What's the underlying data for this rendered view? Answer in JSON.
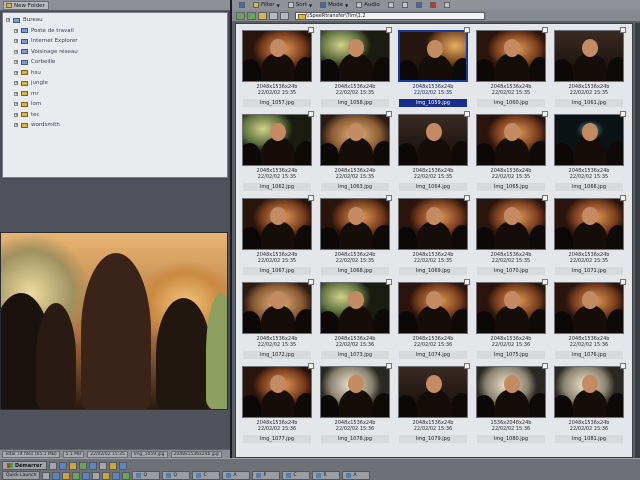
{
  "left": {
    "new_folder_label": "New Folder",
    "tree": [
      {
        "label": "Bureau",
        "kind": "sys",
        "indent": false
      },
      {
        "label": "Poste de travail",
        "kind": "sys",
        "indent": true
      },
      {
        "label": "Internet Explorer",
        "kind": "sys",
        "indent": true
      },
      {
        "label": "Voisinage réseau",
        "kind": "sys",
        "indent": true
      },
      {
        "label": "Corbeille",
        "kind": "sys",
        "indent": true
      },
      {
        "label": "hsu",
        "kind": "folder",
        "indent": true
      },
      {
        "label": "jungle",
        "kind": "folder",
        "indent": true
      },
      {
        "label": "mr",
        "kind": "folder",
        "indent": true
      },
      {
        "label": "lom",
        "kind": "folder",
        "indent": true
      },
      {
        "label": "tec",
        "kind": "folder",
        "indent": true
      },
      {
        "label": "wordsmith",
        "kind": "folder",
        "indent": true
      }
    ],
    "status": {
      "total": "Total 74 files (65.1 MB)",
      "size": "5.1 MB",
      "date": "22/02/02 15:35",
      "file": "Img_1059.jpg",
      "dims": "2048x1536x24b jpg"
    }
  },
  "toolbar": {
    "filter_label": "Filter",
    "sort_label": "Sort",
    "mode_label": "Mode",
    "audio_label": "Audio"
  },
  "address": {
    "path": "\\\\SpeeRtransfer\\Tim\\1.2"
  },
  "thumbnails": [
    {
      "name": "Img_1057.jpg",
      "dims": "2048x1536x24b",
      "date": "22/02/02 15:35",
      "selected": false,
      "scene": "a"
    },
    {
      "name": "Img_1058.jpg",
      "dims": "2048x1536x24b",
      "date": "22/02/02 15:35",
      "selected": false,
      "scene": "b"
    },
    {
      "name": "Img_1059.jpg",
      "dims": "2048x1536x24b",
      "date": "22/02/02 15:35",
      "selected": true,
      "scene": "c"
    },
    {
      "name": "Img_1060.jpg",
      "dims": "2048x1536x24b",
      "date": "22/02/02 15:35",
      "selected": false,
      "scene": "a"
    },
    {
      "name": "Img_1061.jpg",
      "dims": "2048x1536x24b",
      "date": "22/02/02 15:35",
      "selected": false,
      "scene": "d"
    },
    {
      "name": "Img_1062.jpg",
      "dims": "2048x1536x24b",
      "date": "22/02/02 15:35",
      "selected": false,
      "scene": "b"
    },
    {
      "name": "Img_1063.jpg",
      "dims": "2048x1536x24b",
      "date": "22/02/02 15:35",
      "selected": false,
      "scene": "e"
    },
    {
      "name": "Img_1064.jpg",
      "dims": "2048x1536x24b",
      "date": "22/02/02 15:35",
      "selected": false,
      "scene": "d"
    },
    {
      "name": "Img_1065.jpg",
      "dims": "2048x1536x24b",
      "date": "22/02/02 15:35",
      "selected": false,
      "scene": "a"
    },
    {
      "name": "Img_1066.jpg",
      "dims": "2048x1536x24b",
      "date": "22/02/02 15:35",
      "selected": false,
      "scene": "f"
    },
    {
      "name": "Img_1067.jpg",
      "dims": "2048x1536x24b",
      "date": "22/02/02 15:35",
      "selected": false,
      "scene": "a"
    },
    {
      "name": "Img_1068.jpg",
      "dims": "2048x1536x24b",
      "date": "22/02/02 15:35",
      "selected": false,
      "scene": "a"
    },
    {
      "name": "Img_1069.jpg",
      "dims": "2048x1536x24b",
      "date": "22/02/02 15:35",
      "selected": false,
      "scene": "a"
    },
    {
      "name": "Img_1070.jpg",
      "dims": "2048x1536x24b",
      "date": "22/02/02 15:35",
      "selected": false,
      "scene": "a"
    },
    {
      "name": "Img_1071.jpg",
      "dims": "2048x1536x24b",
      "date": "22/02/02 15:35",
      "selected": false,
      "scene": "a"
    },
    {
      "name": "Img_1072.jpg",
      "dims": "2048x1536x24b",
      "date": "22/02/02 15:35",
      "selected": false,
      "scene": "e"
    },
    {
      "name": "Img_1073.jpg",
      "dims": "2048x1536x24b",
      "date": "22/02/02 15:36",
      "selected": false,
      "scene": "b"
    },
    {
      "name": "Img_1074.jpg",
      "dims": "2048x1536x24b",
      "date": "22/02/02 15:36",
      "selected": false,
      "scene": "a"
    },
    {
      "name": "Img_1075.jpg",
      "dims": "2048x1536x24b",
      "date": "22/02/02 15:36",
      "selected": false,
      "scene": "a"
    },
    {
      "name": "Img_1076.jpg",
      "dims": "2048x1536x24b",
      "date": "22/02/02 15:36",
      "selected": false,
      "scene": "a"
    },
    {
      "name": "Img_1077.jpg",
      "dims": "2048x1536x24b",
      "date": "22/02/02 15:36",
      "selected": false,
      "scene": "a"
    },
    {
      "name": "Img_1078.jpg",
      "dims": "2048x1536x24b",
      "date": "22/02/02 15:36",
      "selected": false,
      "scene": "g"
    },
    {
      "name": "Img_1079.jpg",
      "dims": "2048x1536x24b",
      "date": "22/02/02 15:36",
      "selected": false,
      "scene": "d"
    },
    {
      "name": "Img_1080.jpg",
      "dims": "1536x2048x24b",
      "date": "22/02/02 15:36",
      "selected": false,
      "scene": "g"
    },
    {
      "name": "Img_1081.jpg",
      "dims": "2048x1536x24b",
      "date": "22/02/02 15:36",
      "selected": false,
      "scene": "g"
    }
  ],
  "taskbar": {
    "start_label": "Démarrer",
    "quick_launch_label": "Quick Launch",
    "tasks": [
      "Q",
      "Q",
      "C",
      "A",
      "P",
      "C",
      "R",
      "A"
    ]
  }
}
